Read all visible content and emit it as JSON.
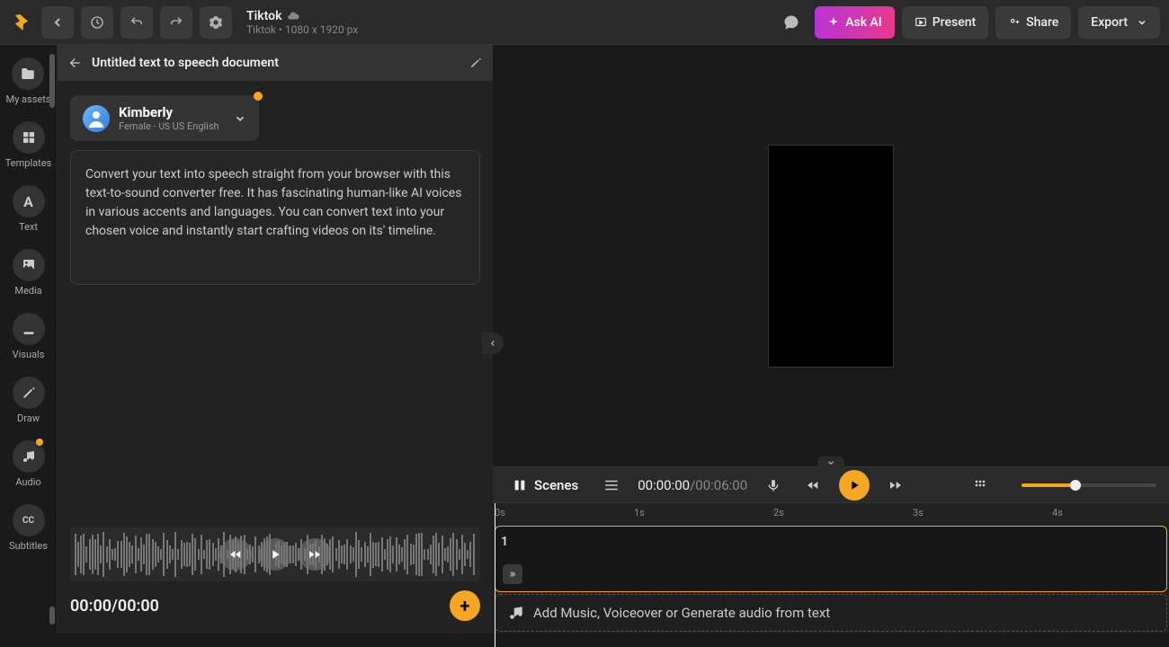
{
  "project": {
    "name": "Tiktok",
    "subtitle": "Tiktok • 1080 x 1920 px"
  },
  "topbar": {
    "ask_ai": "Ask AI",
    "present": "Present",
    "share": "Share",
    "export": "Export"
  },
  "sidebar": {
    "items": [
      {
        "label": "My assets",
        "icon": "folder"
      },
      {
        "label": "Templates",
        "icon": "grid"
      },
      {
        "label": "Text",
        "icon": "text"
      },
      {
        "label": "Media",
        "icon": "image"
      },
      {
        "label": "Visuals",
        "icon": "download"
      },
      {
        "label": "Draw",
        "icon": "pencil"
      },
      {
        "label": "Audio",
        "icon": "music",
        "dot": true
      },
      {
        "label": "Subtitles",
        "icon": "cc"
      }
    ]
  },
  "doc": {
    "title": "Untitled text to speech document",
    "voice": {
      "name": "Kimberly",
      "desc_prefix": "Female - ",
      "flag": "US",
      "lang": "US English"
    },
    "body": "Convert your text into speech straight from your browser with this text-to-sound converter free. It has fascinating human-like AI voices in various accents and languages. You can convert text into your chosen voice and instantly start crafting videos on its' timeline.",
    "wave_time_current": "00:00",
    "wave_time_total": "00:00"
  },
  "timeline": {
    "scenes_label": "Scenes",
    "current": "00:00:00",
    "total": "00:06:00",
    "ruler": [
      "0s",
      "1s",
      "2s",
      "3s",
      "4s"
    ],
    "scene_number": "1",
    "audio_prompt": "Add Music, Voiceover or Generate audio from text"
  },
  "colors": {
    "accent": "#f5a623"
  }
}
